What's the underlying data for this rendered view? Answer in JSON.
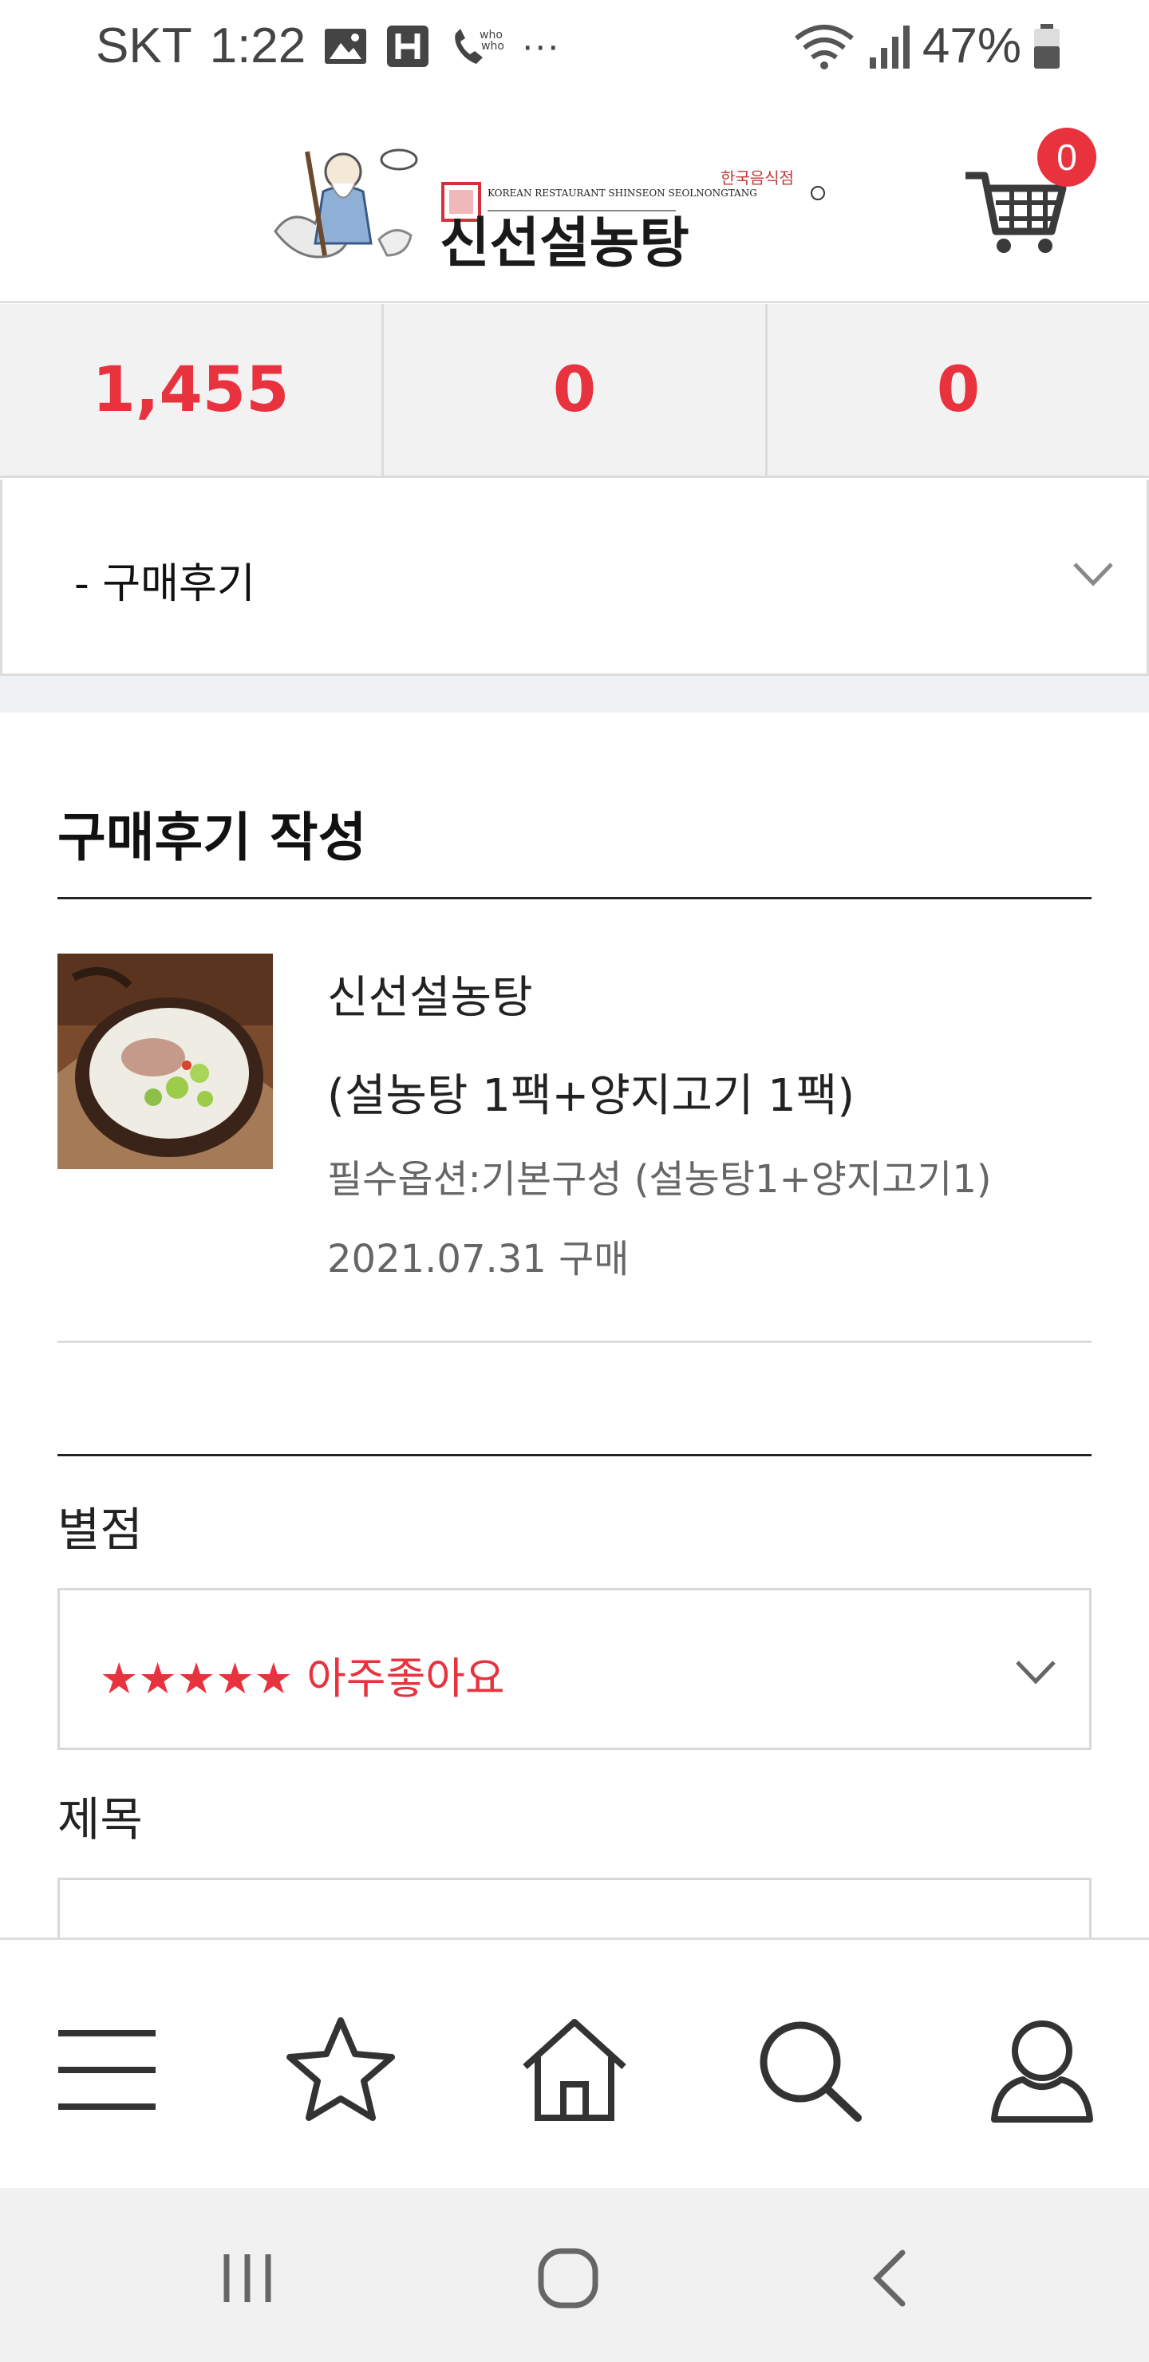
{
  "status_bar": {
    "carrier": "SKT",
    "time": "1:22",
    "ellipsis": "···",
    "battery": "47%",
    "icons": [
      "image-icon",
      "h-badge-icon",
      "whowho-call-icon",
      "wifi-icon",
      "signal-icon",
      "battery-icon"
    ]
  },
  "header": {
    "logo_text": "신선설농탕",
    "logo_subtext": "KOREAN RESTAURANT SHINSEON SEOLNONGTANG",
    "logo_tag": "한국음식점",
    "cart_count": "0"
  },
  "stats": [
    "1,455",
    "0",
    "0"
  ],
  "category": {
    "selected": "- 구매후기"
  },
  "review": {
    "section_title": "구매후기 작성",
    "product_name": "신선설농탕",
    "product_sub": "(설농탕 1팩+양지고기 1팩)",
    "product_option": "필수옵션:기본구성 (설농탕1+양지고기1)",
    "purchase_date": "2021.07.31 구매",
    "rating_label": "별점",
    "rating_value": "★★★★★ 아주좋아요",
    "title_label": "제목"
  },
  "bottom_nav": [
    "menu-icon",
    "star-icon",
    "home-icon",
    "search-icon",
    "user-icon"
  ],
  "system_nav": [
    "recent-apps-icon",
    "home-circle-icon",
    "back-icon"
  ],
  "colors": {
    "accent": "#e8333f",
    "border": "#dcdcdc",
    "band": "#eef2f5"
  }
}
